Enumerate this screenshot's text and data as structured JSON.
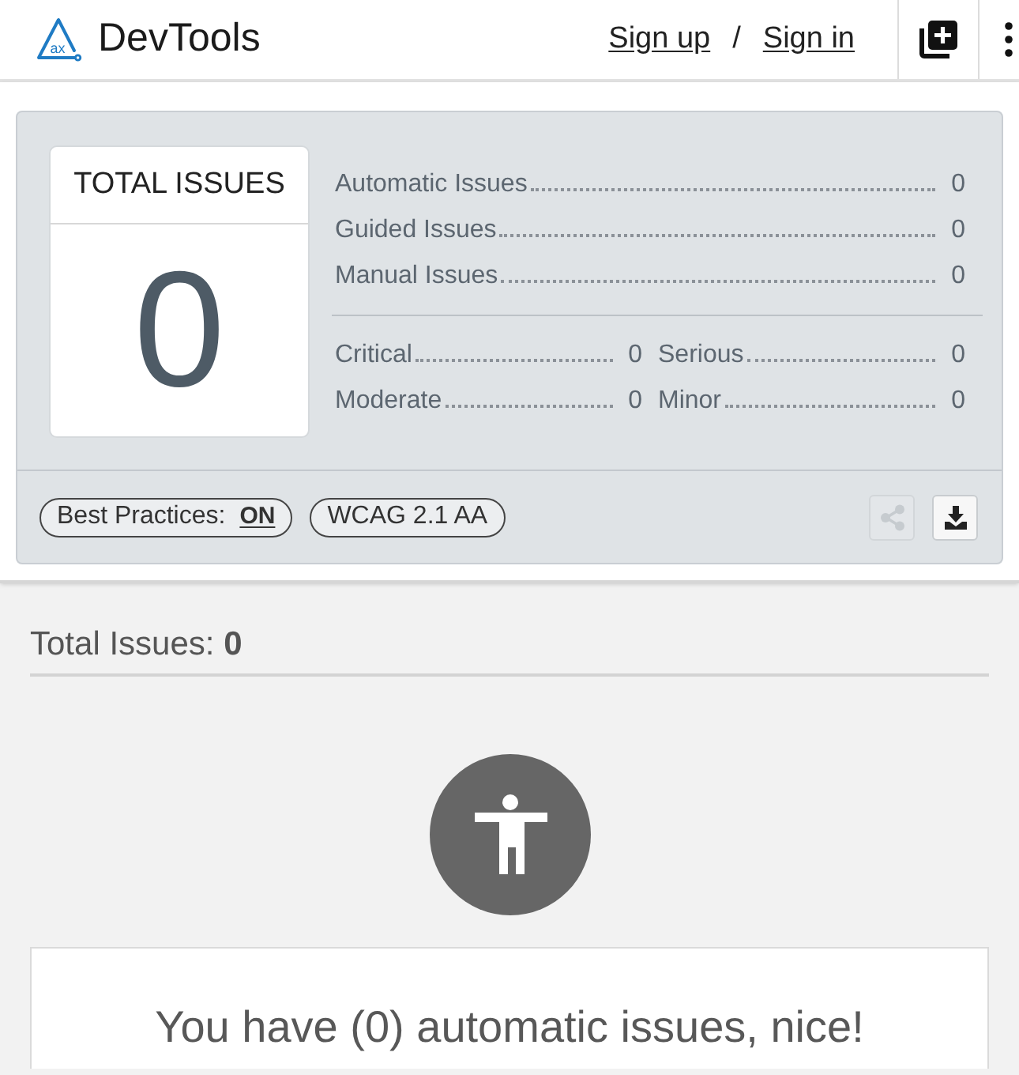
{
  "header": {
    "logo_mark": "ax",
    "brand": "DevTools",
    "sign_up": "Sign up",
    "separator": "/",
    "sign_in": "Sign in"
  },
  "summary": {
    "total_card": {
      "title": "TOTAL ISSUES",
      "value": "0"
    },
    "issue_types": [
      {
        "label": "Automatic Issues",
        "count": "0"
      },
      {
        "label": "Guided Issues",
        "count": "0"
      },
      {
        "label": "Manual Issues",
        "count": "0"
      }
    ],
    "impacts": [
      {
        "label": "Critical",
        "count": "0"
      },
      {
        "label": "Serious",
        "count": "0"
      },
      {
        "label": "Moderate",
        "count": "0"
      },
      {
        "label": "Minor",
        "count": "0"
      }
    ],
    "best_practices": {
      "label": "Best Practices:",
      "value": "ON"
    },
    "standard": "WCAG 2.1 AA",
    "actions": [
      {
        "kind": "share",
        "disabled": true
      },
      {
        "kind": "download",
        "disabled": false
      }
    ]
  },
  "results": {
    "heading": "Total Issues: **0**",
    "message": "You have (0) automatic issues, nice!"
  }
}
